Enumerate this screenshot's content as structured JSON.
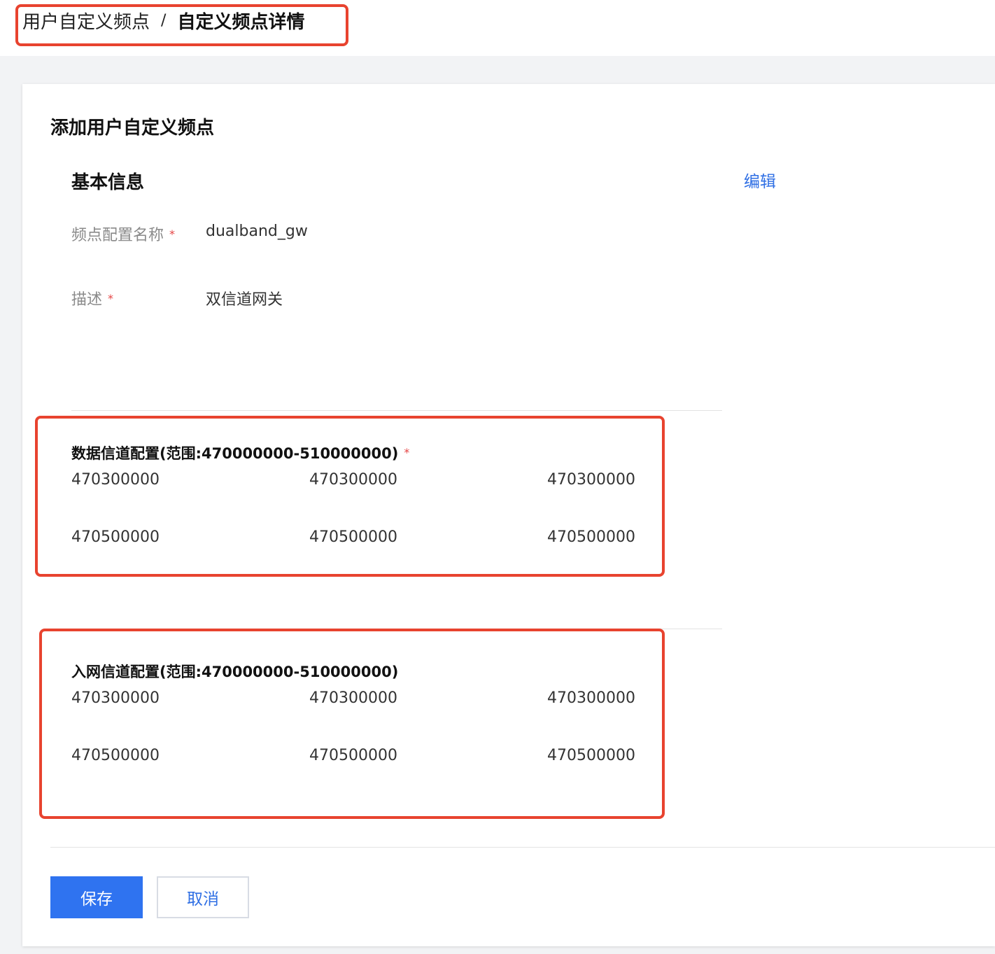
{
  "breadcrumb": {
    "parent": "用户自定义频点",
    "separator": "/",
    "current": "自定义频点详情"
  },
  "card": {
    "title": "添加用户自定义频点"
  },
  "basic_info": {
    "title": "基本信息",
    "edit_label": "编辑",
    "required_mark": "*",
    "fields": [
      {
        "label": "频点配置名称",
        "value": "dualband_gw",
        "required": true
      },
      {
        "label": "描述",
        "value": "双信道网关",
        "required": true
      }
    ]
  },
  "data_channel": {
    "title": "数据信道配置(范围:470000000-510000000)",
    "required": true,
    "rows": [
      [
        "470300000",
        "470300000",
        "470300000"
      ],
      [
        "470500000",
        "470500000",
        "470500000"
      ]
    ]
  },
  "join_channel": {
    "title": "入网信道配置(范围:470000000-510000000)",
    "required": false,
    "rows": [
      [
        "470300000",
        "470300000",
        "470300000"
      ],
      [
        "470500000",
        "470500000",
        "470500000"
      ]
    ]
  },
  "actions": {
    "save_label": "保存",
    "cancel_label": "取消"
  },
  "colors": {
    "primary": "#2f73f0",
    "link": "#2f6fe4",
    "annotation": "#e8432f",
    "required": "#e54545",
    "page_background": "#f2f3f5"
  }
}
